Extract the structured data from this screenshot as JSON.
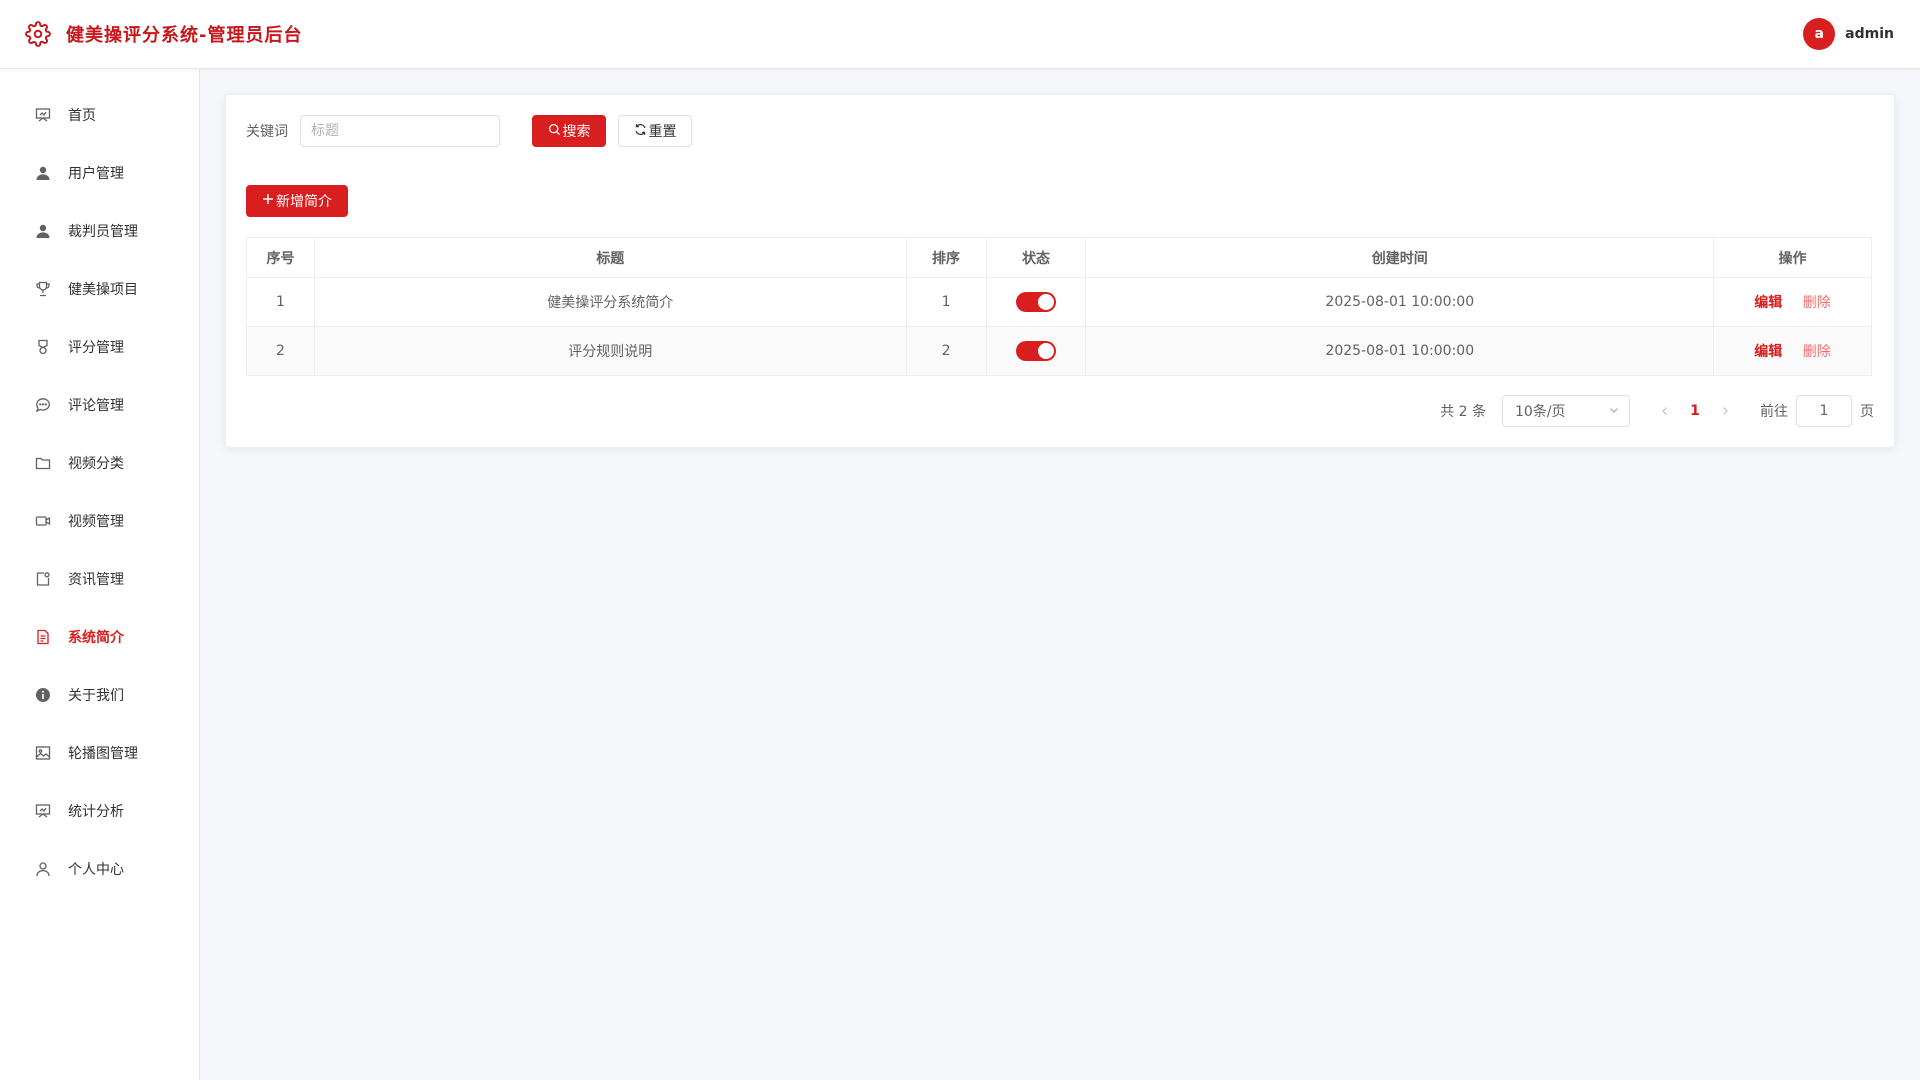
{
  "header": {
    "title": "健美操评分系统-管理员后台",
    "logo_icon": "gear-icon",
    "user": {
      "avatar_letter": "a",
      "name": "admin",
      "avatar_color": "#d81e1e"
    }
  },
  "sidebar": {
    "items": [
      {
        "label": "首页",
        "icon": "presentation-icon",
        "active": false
      },
      {
        "label": "用户管理",
        "icon": "user-icon",
        "active": false
      },
      {
        "label": "裁判员管理",
        "icon": "user-icon",
        "active": false
      },
      {
        "label": "健美操项目",
        "icon": "trophy-icon",
        "active": false
      },
      {
        "label": "评分管理",
        "icon": "medal-icon",
        "active": false
      },
      {
        "label": "评论管理",
        "icon": "chat-icon",
        "active": false
      },
      {
        "label": "视频分类",
        "icon": "folder-icon",
        "active": false
      },
      {
        "label": "视频管理",
        "icon": "video-camera-icon",
        "active": false
      },
      {
        "label": "资讯管理",
        "icon": "news-icon",
        "active": false
      },
      {
        "label": "系统简介",
        "icon": "document-icon",
        "active": true
      },
      {
        "label": "关于我们",
        "icon": "info-icon",
        "active": false
      },
      {
        "label": "轮播图管理",
        "icon": "picture-icon",
        "active": false
      },
      {
        "label": "统计分析",
        "icon": "chart-icon",
        "active": false
      },
      {
        "label": "个人中心",
        "icon": "user-outline-icon",
        "active": false
      }
    ]
  },
  "search": {
    "label": "关键词",
    "placeholder": "标题",
    "value": "",
    "search_button": "搜索",
    "reset_button": "重置"
  },
  "actions": {
    "add_button": "新增简介"
  },
  "table": {
    "columns": [
      "序号",
      "标题",
      "排序",
      "状态",
      "创建时间",
      "操作"
    ],
    "rows": [
      {
        "index": "1",
        "title": "健美操评分系统简介",
        "sort": "1",
        "status": true,
        "created": "2025-08-01 10:00:00",
        "edit": "编辑",
        "delete": "删除"
      },
      {
        "index": "2",
        "title": "评分规则说明",
        "sort": "2",
        "status": true,
        "created": "2025-08-01 10:00:00",
        "edit": "编辑",
        "delete": "删除"
      }
    ]
  },
  "pagination": {
    "total_text": "共 2 条",
    "page_size": "10条/页",
    "current_page": "1",
    "goto_label": "前往",
    "goto_value": "1",
    "goto_unit": "页"
  },
  "theme": {
    "accent": "#d81e1e",
    "brand_text": "#c8161d"
  }
}
